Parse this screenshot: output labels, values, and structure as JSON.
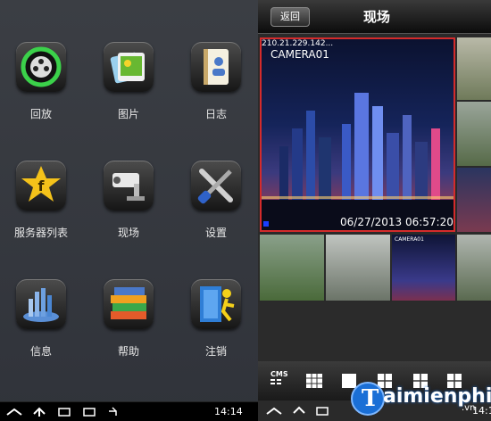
{
  "left_apps": [
    {
      "label": "回放",
      "icon": "playback-film-icon"
    },
    {
      "label": "图片",
      "icon": "photo-album-icon"
    },
    {
      "label": "日志",
      "icon": "log-notebook-icon"
    },
    {
      "label": "服务器列表",
      "icon": "server-list-star-icon"
    },
    {
      "label": "现场",
      "icon": "live-camera-icon"
    },
    {
      "label": "设置",
      "icon": "settings-tools-icon"
    },
    {
      "label": "信息",
      "icon": "info-chart-icon"
    },
    {
      "label": "帮助",
      "icon": "help-books-icon"
    },
    {
      "label": "注销",
      "icon": "logout-door-icon"
    }
  ],
  "live_view": {
    "back_label": "返回",
    "title": "现场",
    "main_camera": {
      "ip": "210.21.229.142...",
      "name": "CAMERA01",
      "timestamp": "06/27/2013 06:57:20"
    },
    "small_camera_label": "CAMERA01"
  },
  "bottom_toolbar": {
    "cms_label": "CMS"
  },
  "watermark": {
    "text": "aimienphi",
    "suffix": ".vn"
  },
  "system_bar": {
    "left_clock": "14:14",
    "right_clock": "14:1"
  },
  "colors": {
    "accent_red": "#d42b2b",
    "panel_bg": "#33363c",
    "brand_blue": "#1a6fd6"
  }
}
